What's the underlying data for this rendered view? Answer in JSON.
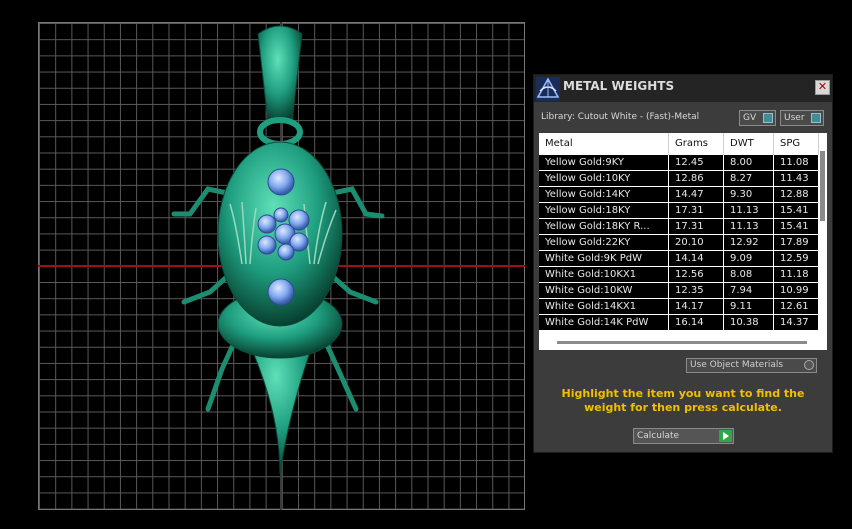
{
  "panel": {
    "title": "METAL WEIGHTS",
    "close_label": "✕",
    "library_label": "Library: Cutout White - (Fast)-Metal",
    "toggles": [
      {
        "label": "GV",
        "icon": "toggle-knob-icon"
      },
      {
        "label": "User",
        "icon": "toggle-knob-icon"
      }
    ],
    "use_object_materials": "Use Object Materials",
    "hint": "Highlight the item you want to find the weight for then press calculate.",
    "calculate_label": "Calculate",
    "accent_color": "#3f8f90",
    "hint_color": "#f0c000",
    "calculate_icon_color": "#2fa84b"
  },
  "table": {
    "columns": [
      "Metal",
      "Grams",
      "DWT",
      "SPG"
    ],
    "rows": [
      [
        "Yellow Gold:9KY",
        "12.45",
        "8.00",
        "11.08"
      ],
      [
        "Yellow Gold:10KY",
        "12.86",
        "8.27",
        "11.43"
      ],
      [
        "Yellow Gold:14KY",
        "14.47",
        "9.30",
        "12.88"
      ],
      [
        "Yellow Gold:18KY",
        "17.31",
        "11.13",
        "15.41"
      ],
      [
        "Yellow Gold:18KY R...",
        "17.31",
        "11.13",
        "15.41"
      ],
      [
        "Yellow Gold:22KY",
        "20.10",
        "12.92",
        "17.89"
      ],
      [
        "White Gold:9K PdW",
        "14.14",
        "9.09",
        "12.59"
      ],
      [
        "White Gold:10KX1",
        "12.56",
        "8.08",
        "11.18"
      ],
      [
        "White Gold:10KW",
        "12.35",
        "7.94",
        "10.99"
      ],
      [
        "White Gold:14KX1",
        "14.17",
        "9.11",
        "12.61"
      ],
      [
        "White Gold:14K PdW",
        "16.14",
        "10.38",
        "14.37"
      ]
    ]
  },
  "viewport": {
    "model_color": "#1f9f80",
    "gem_color": "#7fa8ee",
    "grid_color": "#5a5a5a",
    "x_axis_color": "#a01010"
  }
}
